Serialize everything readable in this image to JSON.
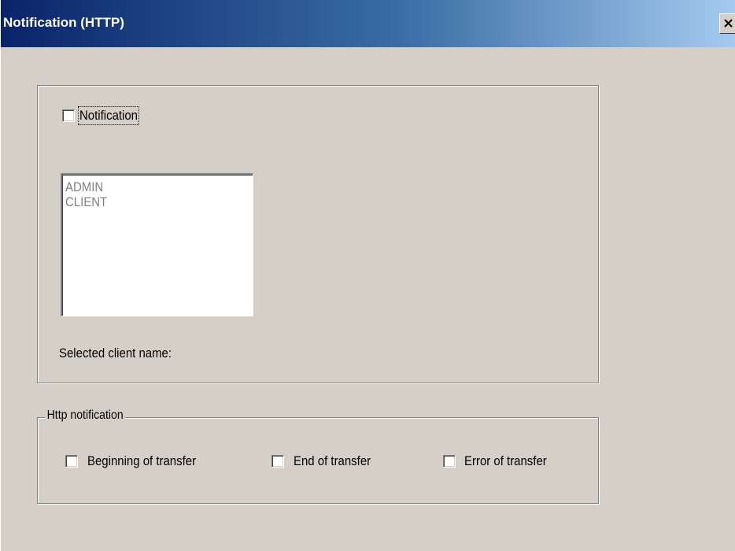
{
  "window": {
    "title": "Notification (HTTP)",
    "close_glyph": "X"
  },
  "notification": {
    "checkbox_label": "Notification",
    "checked": false
  },
  "client_list": {
    "items": [
      "ADMIN",
      "CLIENT"
    ]
  },
  "selected_client_label": "Selected client name:",
  "http_notification": {
    "legend": "Http notification",
    "options": [
      {
        "label": "Beginning of transfer",
        "checked": false
      },
      {
        "label": "End of transfer",
        "checked": false
      },
      {
        "label": "Error of transfer",
        "checked": false
      }
    ]
  },
  "colors": {
    "titlebar_start": "#0a246a",
    "titlebar_end": "#a6caf0",
    "dialog_background": "#d4d0c8",
    "disabled_text": "#808080"
  }
}
